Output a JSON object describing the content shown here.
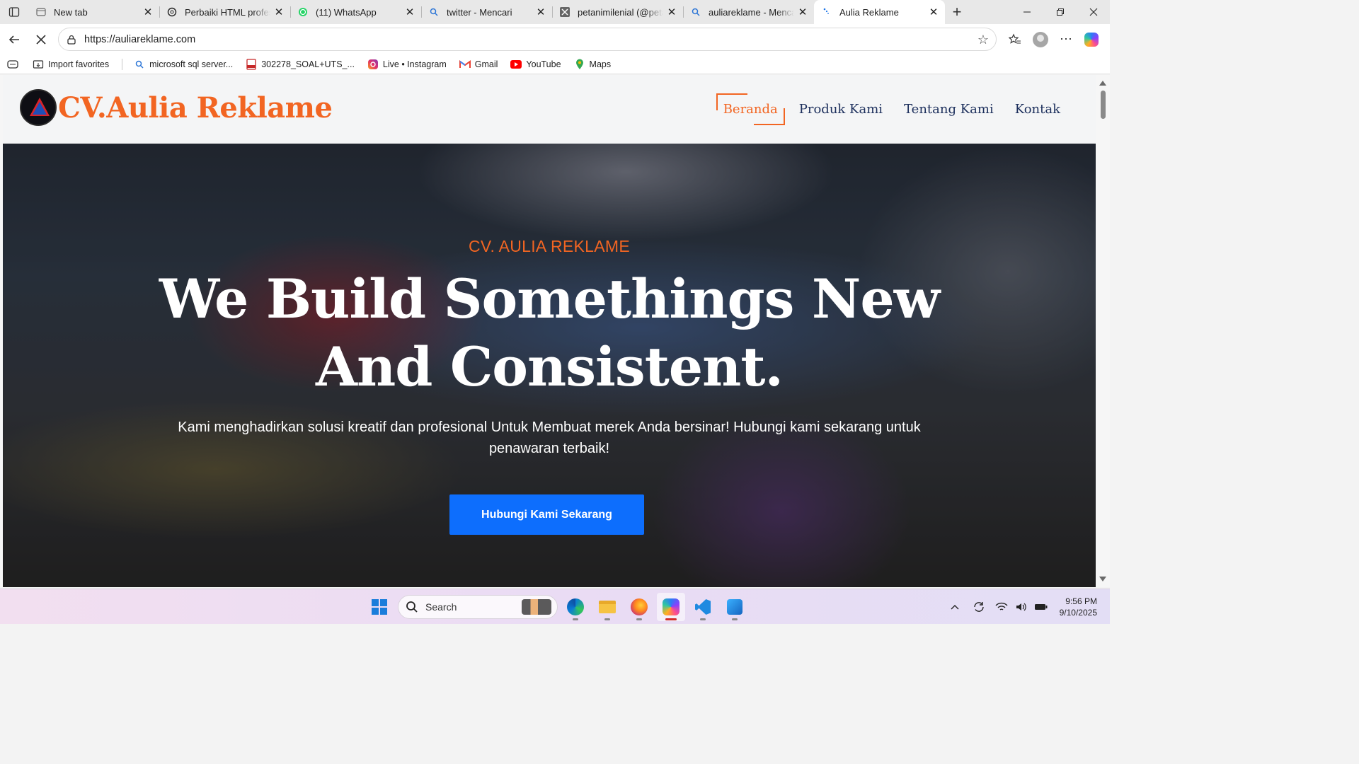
{
  "browser": {
    "tabs": [
      {
        "title": "New tab",
        "icon": "newtab-icon"
      },
      {
        "title": "Perbaiki HTML profesional",
        "icon": "chatgpt-icon"
      },
      {
        "title": "(11) WhatsApp",
        "icon": "whatsapp-icon"
      },
      {
        "title": "twitter - Mencari",
        "icon": "bing-search-icon"
      },
      {
        "title": "petanimilenial (@petanimilenial)",
        "icon": "x-icon"
      },
      {
        "title": "auliareklame - Mencari",
        "icon": "bing-search-icon"
      },
      {
        "title": "Aulia Reklame",
        "icon": "loading-icon",
        "active": true
      }
    ],
    "url": "https://auliareklame.com",
    "favorites": [
      {
        "label": "Import favorites",
        "icon": "import-icon"
      },
      {
        "label": "microsoft sql server...",
        "icon": "search-icon"
      },
      {
        "label": "302278_SOAL+UTS_...",
        "icon": "pdf-icon"
      },
      {
        "label": "Live • Instagram",
        "icon": "instagram-icon"
      },
      {
        "label": "Gmail",
        "icon": "gmail-icon"
      },
      {
        "label": "YouTube",
        "icon": "youtube-icon"
      },
      {
        "label": "Maps",
        "icon": "maps-icon"
      }
    ]
  },
  "site": {
    "brand": "CV.Aulia Reklame",
    "nav": [
      {
        "label": "Beranda",
        "active": true
      },
      {
        "label": "Produk Kami"
      },
      {
        "label": "Tentang Kami"
      },
      {
        "label": "Kontak"
      }
    ],
    "hero": {
      "kicker": "CV. AULIA REKLAME",
      "title": "We Build Somethings New And Consistent.",
      "subtitle": "Kami menghadirkan solusi kreatif dan profesional Untuk Membuat merek Anda bersinar! Hubungi kami sekarang untuk penawaran terbaik!",
      "cta": "Hubungi Kami Sekarang"
    },
    "colors": {
      "accent": "#f26522",
      "nav_text": "#1c2f5c",
      "cta": "#0d6efd"
    }
  },
  "taskbar": {
    "search_placeholder": "Search",
    "time": "9:56 PM",
    "date": "9/10/2025"
  }
}
